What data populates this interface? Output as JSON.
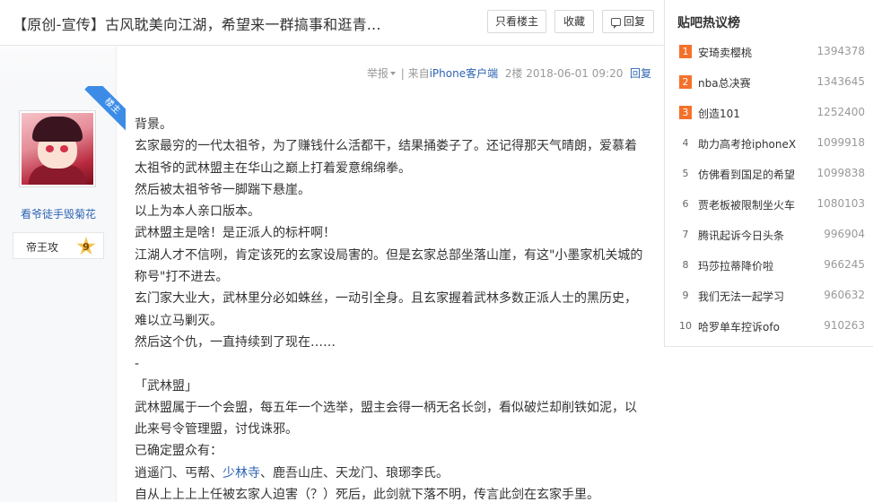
{
  "thread": {
    "title": "【原创-宣传】古风耽美向江湖，希望来一群搞事和逛青...",
    "buttons": {
      "only_op": "只看楼主",
      "favorite": "收藏",
      "reply": "回复"
    }
  },
  "post": {
    "meta": {
      "report": "举报",
      "from_prefix": "| 来自",
      "client": "iPhone客户端",
      "floor": "2楼",
      "time": "2018-06-01 09:20",
      "reply": "回复"
    },
    "author": {
      "ribbon": "楼主",
      "name": "看爷徒手毁菊花",
      "badge_label": "帝王攻",
      "level": "9"
    },
    "lines": [
      "背景。",
      "玄家最穷的一代太祖爷，为了赚钱什么活都干，结果捅娄子了。还记得那天气晴朗，爱慕着",
      "太祖爷的武林盟主在华山之巅上打着爱意绵绵拳。",
      "然后被太祖爷爷一脚踹下悬崖。",
      "以上为本人亲口版本。",
      "武林盟主是啥！是正派人的标杆啊！",
      "江湖人才不信咧，肯定该死的玄家设局害的。但是玄家总部坐落山崖，有这\"小墨家机关城的",
      "称号\"打不进去。",
      "玄门家大业大，武林里分必如蛛丝，一动引全身。且玄家握着武林多数正派人士的黑历史，",
      "难以立马剿灭。",
      "然后这个仇，一直持续到了现在……",
      "-",
      "「武林盟」",
      "武林盟属于一个会盟，每五年一个选举，盟主会得一柄无名长剑，看似破烂却削铁如泥，以",
      "此来号令管理盟，讨伐诛邪。",
      "已确定盟众有："
    ],
    "sects": {
      "before": "逍遥门、丐帮、",
      "link": "少林寺",
      "after": "、鹿吾山庄、天龙门、琅琊李氏。"
    },
    "last_line": "自从上上上上任被玄家人迫害（？）死后，此剑就下落不明，传言此剑在玄家手里。"
  },
  "sidebar": {
    "title": "贴吧热议榜",
    "items": [
      {
        "rank": "1",
        "name": "安琦卖樱桃",
        "count": "1394378"
      },
      {
        "rank": "2",
        "name": "nba总决赛",
        "count": "1343645"
      },
      {
        "rank": "3",
        "name": "创造101",
        "count": "1252400"
      },
      {
        "rank": "4",
        "name": "助力高考抢iphoneX",
        "count": "1099918"
      },
      {
        "rank": "5",
        "name": "仿佛看到国足的希望",
        "count": "1099838"
      },
      {
        "rank": "6",
        "name": "贾老板被限制坐火车",
        "count": "1080103"
      },
      {
        "rank": "7",
        "name": "腾讯起诉今日头条",
        "count": "996904"
      },
      {
        "rank": "8",
        "name": "玛莎拉蒂降价啦",
        "count": "966245"
      },
      {
        "rank": "9",
        "name": "我们无法一起学习",
        "count": "960632"
      },
      {
        "rank": "10",
        "name": "哈罗单车控诉ofo",
        "count": "910263"
      }
    ]
  }
}
